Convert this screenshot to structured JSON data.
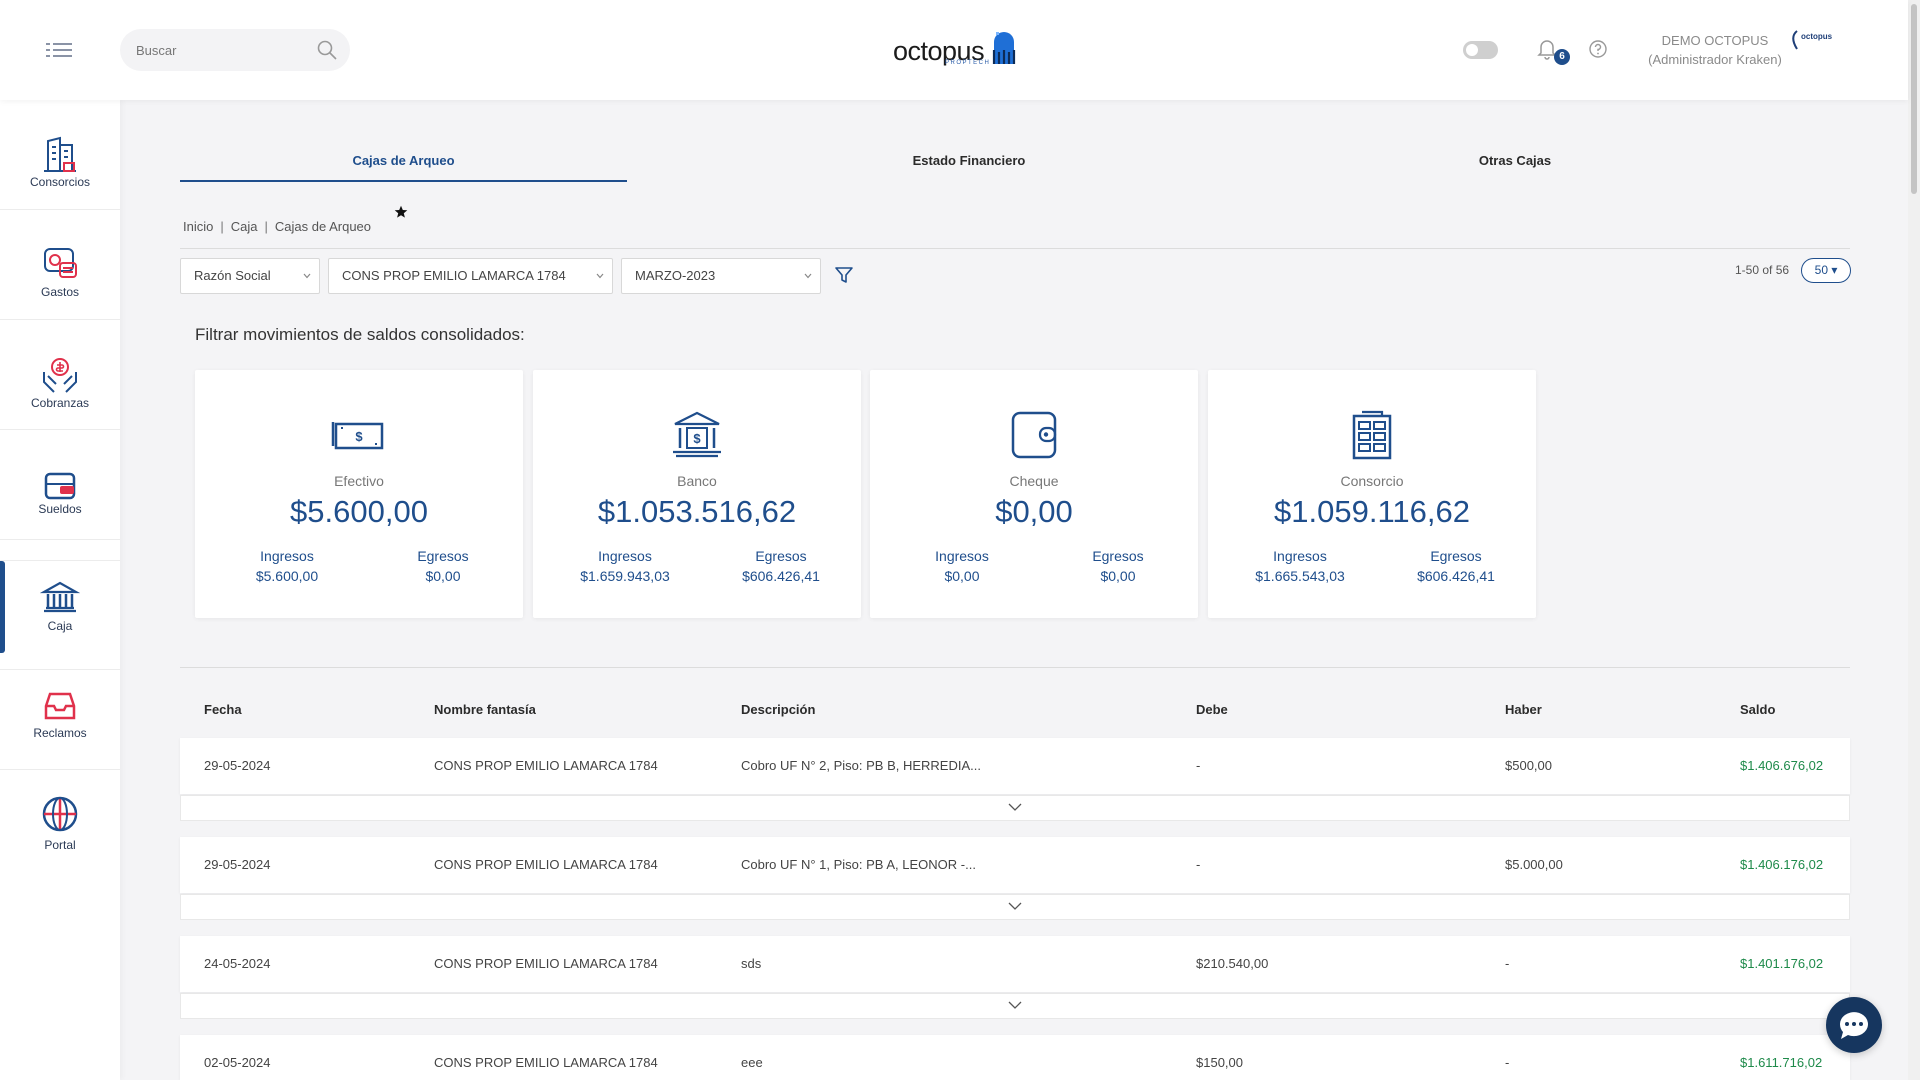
{
  "header": {
    "search_placeholder": "Buscar",
    "brand": "octopus",
    "brand_sub": "PROPTECH",
    "notifications_count": "6",
    "user_name": "DEMO OCTOPUS",
    "user_role": "(Administrador Kraken)",
    "user_logo_text": "octopus"
  },
  "sidebar": {
    "items": [
      {
        "label": "Consorcios",
        "icon": "building-icon"
      },
      {
        "label": "Gastos",
        "icon": "expenses-icon"
      },
      {
        "label": "Cobranzas",
        "icon": "collections-icon"
      },
      {
        "label": "Sueldos",
        "icon": "wallet-icon"
      },
      {
        "label": "Caja",
        "icon": "bank-icon",
        "active": true
      },
      {
        "label": "Reclamos",
        "icon": "inbox-icon"
      },
      {
        "label": "Portal",
        "icon": "globe-icon"
      }
    ]
  },
  "tabs": [
    {
      "label": "Cajas de Arqueo",
      "active": true
    },
    {
      "label": "Estado Financiero"
    },
    {
      "label": "Otras Cajas"
    }
  ],
  "breadcrumb": [
    "Inicio",
    "Caja",
    "Cajas de Arqueo"
  ],
  "filters": {
    "razon_social": "Razón Social",
    "consorcio": "CONS PROP EMILIO LAMARCA 1784",
    "periodo": "MARZO-2023"
  },
  "pagination": {
    "range": "1-50 of 56",
    "page_size": "50"
  },
  "section_title": "Filtrar movimientos de saldos consolidados:",
  "cards": [
    {
      "title": "Efectivo",
      "amount": "$5.600,00",
      "ingresos_label": "Ingresos",
      "ingresos": "$5.600,00",
      "egresos_label": "Egresos",
      "egresos": "$0,00"
    },
    {
      "title": "Banco",
      "amount": "$1.053.516,62",
      "ingresos_label": "Ingresos",
      "ingresos": "$1.659.943,03",
      "egresos_label": "Egresos",
      "egresos": "$606.426,41"
    },
    {
      "title": "Cheque",
      "amount": "$0,00",
      "ingresos_label": "Ingresos",
      "ingresos": "$0,00",
      "egresos_label": "Egresos",
      "egresos": "$0,00"
    },
    {
      "title": "Consorcio",
      "amount": "$1.059.116,62",
      "ingresos_label": "Ingresos",
      "ingresos": "$1.665.543,03",
      "egresos_label": "Egresos",
      "egresos": "$606.426,41"
    }
  ],
  "table": {
    "columns": [
      "Fecha",
      "Nombre fantasía",
      "Descripción",
      "Debe",
      "Haber",
      "Saldo"
    ],
    "rows": [
      [
        "29-05-2024",
        "CONS PROP EMILIO LAMARCA 1784",
        "Cobro UF N° 2, Piso: PB B, HERREDIA...",
        "-",
        "$500,00",
        "$1.406.676,02"
      ],
      [
        "29-05-2024",
        "CONS PROP EMILIO LAMARCA 1784",
        "Cobro UF N° 1, Piso: PB A, LEONOR -...",
        "-",
        "$5.000,00",
        "$1.406.176,02"
      ],
      [
        "24-05-2024",
        "CONS PROP EMILIO LAMARCA 1784",
        "sds",
        "$210.540,00",
        "-",
        "$1.401.176,02"
      ],
      [
        "02-05-2024",
        "CONS PROP EMILIO LAMARCA 1784",
        "eee",
        "$150,00",
        "-",
        "$1.611.716,02"
      ]
    ]
  },
  "colors": {
    "primary": "#1f4e8c",
    "saldo": "#1e8a4a",
    "accent_red": "#e0314b"
  }
}
